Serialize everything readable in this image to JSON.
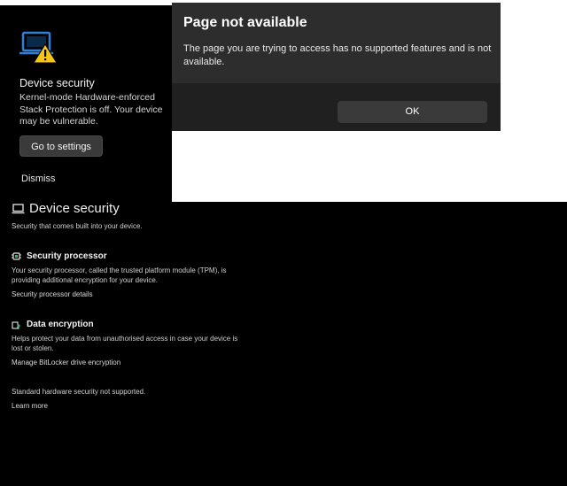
{
  "toast": {
    "title": "Device security",
    "body": "Kernel-mode Hardware-enforced Stack Protection is off. Your device may be vulnerable.",
    "settings_button": "Go to settings",
    "dismiss": "Dismiss",
    "icon": "laptop-warning-icon"
  },
  "dialog": {
    "title": "Page not available",
    "message": "The page you are trying to access has no supported features and is not available.",
    "ok_button": "OK"
  },
  "page": {
    "title": "Device security",
    "subtitle": "Security that comes built into your device.",
    "sections": [
      {
        "title": "Security processor",
        "description": "Your security processor, called the trusted platform module (TPM), is providing additional encryption for your device.",
        "link": "Security processor details",
        "icon": "chip-icon"
      },
      {
        "title": "Data encryption",
        "description": "Helps protect your data from unauthorised access in case your device is lost or stolen.",
        "link": "Manage BitLocker drive encryption",
        "icon": "key-drive-icon"
      }
    ],
    "footer_note": "Standard hardware security not supported.",
    "footer_link": "Learn more"
  },
  "colors": {
    "warning": "#f5c518",
    "accent": "#2f7fd6"
  }
}
